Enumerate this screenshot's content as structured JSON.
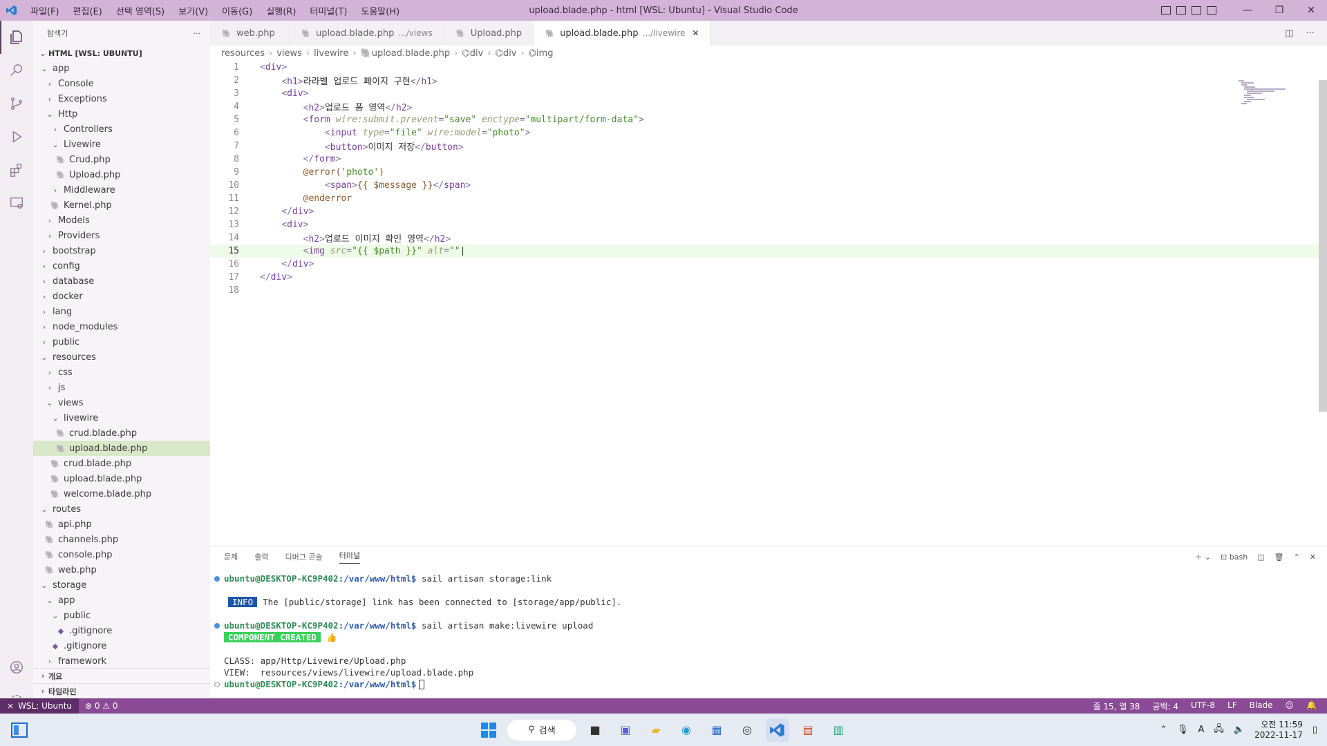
{
  "titlebar": {
    "menu": [
      "파일(F)",
      "편집(E)",
      "선택 영역(S)",
      "보기(V)",
      "이동(G)",
      "실행(R)",
      "터미널(T)",
      "도움말(H)"
    ],
    "title": "upload.blade.php - html [WSL: Ubuntu] - Visual Studio Code",
    "minimize": "—",
    "restore": "❐",
    "close": "✕"
  },
  "sidebar": {
    "header": "탐색기",
    "more": "···",
    "section": "HTML [WSL: UBUNTU]",
    "tree": [
      {
        "label": "app",
        "depth": 1,
        "kind": "folder-open"
      },
      {
        "label": "Console",
        "depth": 2,
        "kind": "folder"
      },
      {
        "label": "Exceptions",
        "depth": 2,
        "kind": "folder"
      },
      {
        "label": "Http",
        "depth": 2,
        "kind": "folder-open"
      },
      {
        "label": "Controllers",
        "depth": 3,
        "kind": "folder"
      },
      {
        "label": "Livewire",
        "depth": 3,
        "kind": "folder-open"
      },
      {
        "label": "Crud.php",
        "depth": 4,
        "kind": "php"
      },
      {
        "label": "Upload.php",
        "depth": 4,
        "kind": "php"
      },
      {
        "label": "Middleware",
        "depth": 3,
        "kind": "folder"
      },
      {
        "label": "Kernel.php",
        "depth": 3,
        "kind": "php"
      },
      {
        "label": "Models",
        "depth": 2,
        "kind": "folder"
      },
      {
        "label": "Providers",
        "depth": 2,
        "kind": "folder"
      },
      {
        "label": "bootstrap",
        "depth": 1,
        "kind": "folder"
      },
      {
        "label": "config",
        "depth": 1,
        "kind": "folder"
      },
      {
        "label": "database",
        "depth": 1,
        "kind": "folder"
      },
      {
        "label": "docker",
        "depth": 1,
        "kind": "folder"
      },
      {
        "label": "lang",
        "depth": 1,
        "kind": "folder"
      },
      {
        "label": "node_modules",
        "depth": 1,
        "kind": "folder"
      },
      {
        "label": "public",
        "depth": 1,
        "kind": "folder"
      },
      {
        "label": "resources",
        "depth": 1,
        "kind": "folder-open"
      },
      {
        "label": "css",
        "depth": 2,
        "kind": "folder"
      },
      {
        "label": "js",
        "depth": 2,
        "kind": "folder"
      },
      {
        "label": "views",
        "depth": 2,
        "kind": "folder-open"
      },
      {
        "label": "livewire",
        "depth": 3,
        "kind": "folder-open"
      },
      {
        "label": "crud.blade.php",
        "depth": 4,
        "kind": "php"
      },
      {
        "label": "upload.blade.php",
        "depth": 4,
        "kind": "php",
        "selected": true
      },
      {
        "label": "crud.blade.php",
        "depth": 3,
        "kind": "php"
      },
      {
        "label": "upload.blade.php",
        "depth": 3,
        "kind": "php"
      },
      {
        "label": "welcome.blade.php",
        "depth": 3,
        "kind": "php"
      },
      {
        "label": "routes",
        "depth": 1,
        "kind": "folder-open"
      },
      {
        "label": "api.php",
        "depth": 2,
        "kind": "php"
      },
      {
        "label": "channels.php",
        "depth": 2,
        "kind": "php"
      },
      {
        "label": "console.php",
        "depth": 2,
        "kind": "php"
      },
      {
        "label": "web.php",
        "depth": 2,
        "kind": "php"
      },
      {
        "label": "storage",
        "depth": 1,
        "kind": "folder-open"
      },
      {
        "label": "app",
        "depth": 2,
        "kind": "folder-open"
      },
      {
        "label": "public",
        "depth": 3,
        "kind": "folder-open"
      },
      {
        "label": ".gitignore",
        "depth": 4,
        "kind": "git"
      },
      {
        "label": ".gitignore",
        "depth": 3,
        "kind": "git"
      },
      {
        "label": "framework",
        "depth": 2,
        "kind": "folder"
      }
    ],
    "bottom": [
      "개요",
      "타임라인"
    ]
  },
  "tabs": [
    {
      "label": "web.php",
      "sub": "",
      "active": false
    },
    {
      "label": "upload.blade.php",
      "sub": ".../views",
      "active": false
    },
    {
      "label": "Upload.php",
      "sub": "",
      "active": false
    },
    {
      "label": "upload.blade.php",
      "sub": ".../livewire",
      "active": true
    }
  ],
  "breadcrumb": [
    "resources",
    "views",
    "livewire",
    "upload.blade.php",
    "div",
    "div",
    "img"
  ],
  "code": {
    "current_line": 15,
    "lines": [
      [
        [
          "tag",
          "<"
        ],
        [
          "name",
          "div"
        ],
        [
          "tag",
          ">"
        ]
      ],
      [
        [
          "ws",
          "    "
        ],
        [
          "tag",
          "<"
        ],
        [
          "name",
          "h1"
        ],
        [
          "tag",
          ">"
        ],
        [
          "txt",
          "라라벨 업로드 페이지 구현"
        ],
        [
          "tag",
          "</"
        ],
        [
          "name",
          "h1"
        ],
        [
          "tag",
          ">"
        ]
      ],
      [
        [
          "ws",
          "    "
        ],
        [
          "tag",
          "<"
        ],
        [
          "name",
          "div"
        ],
        [
          "tag",
          ">"
        ]
      ],
      [
        [
          "ws",
          "        "
        ],
        [
          "tag",
          "<"
        ],
        [
          "name",
          "h2"
        ],
        [
          "tag",
          ">"
        ],
        [
          "txt",
          "업로드 폼 영역"
        ],
        [
          "tag",
          "</"
        ],
        [
          "name",
          "h2"
        ],
        [
          "tag",
          ">"
        ]
      ],
      [
        [
          "ws",
          "        "
        ],
        [
          "tag",
          "<"
        ],
        [
          "name",
          "form"
        ],
        [
          "txt",
          " "
        ],
        [
          "attr",
          "wire:submit.prevent"
        ],
        [
          "tag",
          "="
        ],
        [
          "str",
          "\"save\""
        ],
        [
          "txt",
          " "
        ],
        [
          "attr",
          "enctype"
        ],
        [
          "tag",
          "="
        ],
        [
          "str",
          "\"multipart/form-data\""
        ],
        [
          "tag",
          ">"
        ]
      ],
      [
        [
          "ws",
          "            "
        ],
        [
          "tag",
          "<"
        ],
        [
          "name",
          "input"
        ],
        [
          "txt",
          " "
        ],
        [
          "attr",
          "type"
        ],
        [
          "tag",
          "="
        ],
        [
          "str",
          "\"file\""
        ],
        [
          "txt",
          " "
        ],
        [
          "attr",
          "wire:model"
        ],
        [
          "tag",
          "="
        ],
        [
          "str",
          "\"photo\""
        ],
        [
          "tag",
          ">"
        ]
      ],
      [
        [
          "ws",
          "            "
        ],
        [
          "tag",
          "<"
        ],
        [
          "name",
          "button"
        ],
        [
          "tag",
          ">"
        ],
        [
          "txt",
          "이미지 저장"
        ],
        [
          "tag",
          "</"
        ],
        [
          "name",
          "button"
        ],
        [
          "tag",
          ">"
        ]
      ],
      [
        [
          "ws",
          "        "
        ],
        [
          "tag",
          "</"
        ],
        [
          "name",
          "form"
        ],
        [
          "tag",
          ">"
        ]
      ],
      [
        [
          "ws",
          "        "
        ],
        [
          "blade",
          "@error("
        ],
        [
          "str",
          "'photo'"
        ],
        [
          "blade",
          ")"
        ]
      ],
      [
        [
          "ws",
          "            "
        ],
        [
          "tag",
          "<"
        ],
        [
          "name",
          "span"
        ],
        [
          "tag",
          ">"
        ],
        [
          "blade",
          "{{ $message }}"
        ],
        [
          "tag",
          "</"
        ],
        [
          "name",
          "span"
        ],
        [
          "tag",
          ">"
        ]
      ],
      [
        [
          "ws",
          "        "
        ],
        [
          "blade",
          "@enderror"
        ]
      ],
      [
        [
          "ws",
          "    "
        ],
        [
          "tag",
          "</"
        ],
        [
          "name",
          "div"
        ],
        [
          "tag",
          ">"
        ]
      ],
      [
        [
          "ws",
          "    "
        ],
        [
          "tag",
          "<"
        ],
        [
          "name",
          "div"
        ],
        [
          "tag",
          ">"
        ]
      ],
      [
        [
          "ws",
          "        "
        ],
        [
          "tag",
          "<"
        ],
        [
          "name",
          "h2"
        ],
        [
          "tag",
          ">"
        ],
        [
          "txt",
          "업로드 이미지 확인 영역"
        ],
        [
          "tag",
          "</"
        ],
        [
          "name",
          "h2"
        ],
        [
          "tag",
          ">"
        ]
      ],
      [
        [
          "ws",
          "        "
        ],
        [
          "tag",
          "<"
        ],
        [
          "name",
          "img"
        ],
        [
          "txt",
          " "
        ],
        [
          "attr",
          "src"
        ],
        [
          "tag",
          "="
        ],
        [
          "str",
          "\"{{ $path }}\""
        ],
        [
          "txt",
          " "
        ],
        [
          "attr",
          "alt"
        ],
        [
          "tag",
          "="
        ],
        [
          "str",
          "\"\""
        ]
      ],
      [
        [
          "ws",
          "    "
        ],
        [
          "tag",
          "</"
        ],
        [
          "name",
          "div"
        ],
        [
          "tag",
          ">"
        ]
      ],
      [
        [
          "tag",
          "</"
        ],
        [
          "name",
          "div"
        ],
        [
          "tag",
          ">"
        ]
      ],
      []
    ]
  },
  "panel": {
    "tabs": [
      "문제",
      "출력",
      "디버그 콘솔",
      "터미널"
    ],
    "active_tab": 3,
    "shell": "bash",
    "terminal": {
      "prompt_user": "ubuntu@DESKTOP-KC9P402",
      "prompt_path": ":/var/www/html$",
      "cmd1": " sail artisan storage:link",
      "info_badge": "INFO",
      "info_text": "The [public/storage] link has been connected to [storage/app/public].",
      "cmd2": " sail artisan make:livewire upload",
      "created_badge": "COMPONENT CREATED",
      "created_emoji": "👍",
      "class_line": "CLASS: app/Http/Livewire/Upload.php",
      "view_line": "VIEW:  resources/views/livewire/upload.blade.php"
    }
  },
  "statusbar": {
    "remote": "WSL: Ubuntu",
    "problems": "⊗ 0 ⚠ 0",
    "position": "줄 15, 열 38",
    "spaces": "공백: 4",
    "encoding": "UTF-8",
    "eol": "LF",
    "language": "Blade"
  },
  "taskbar": {
    "search": "검색",
    "time": "오전 11:59",
    "date": "2022-11-17",
    "ime": "A"
  },
  "colors": {
    "titlebar": "#d4b3d8",
    "statusbar": "#8b4a95",
    "selection": "#d8e8c8"
  }
}
